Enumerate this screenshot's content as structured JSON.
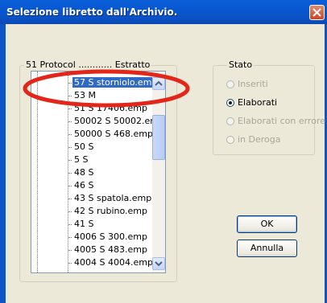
{
  "window": {
    "title": "Selezione libretto dall'Archivio."
  },
  "tree_group": {
    "legend": "51 Protocol ............ Estratto"
  },
  "tree_items": [
    {
      "label": "57 S storniolo.emp",
      "selected": true
    },
    {
      "label": "53 M"
    },
    {
      "label": "51 S 17406.emp"
    },
    {
      "label": "50002 S 50002.emp"
    },
    {
      "label": "50000 S 468.emp"
    },
    {
      "label": "50 S"
    },
    {
      "label": "5 S"
    },
    {
      "label": "48 S"
    },
    {
      "label": "46 S"
    },
    {
      "label": "43 S spatola.emp"
    },
    {
      "label": "42 S rubino.emp"
    },
    {
      "label": "41 S"
    },
    {
      "label": "4006 S 300.emp"
    },
    {
      "label": "4005 S 483.emp"
    },
    {
      "label": "4004 S 4004.emp"
    }
  ],
  "stato": {
    "legend": "Stato",
    "options": [
      {
        "label": "Inseriti",
        "checked": false,
        "enabled": false
      },
      {
        "label": "Elaborati",
        "checked": true,
        "enabled": true
      },
      {
        "label": "Elaborati con errore",
        "checked": false,
        "enabled": false
      },
      {
        "label": "in Deroga",
        "checked": false,
        "enabled": false
      }
    ]
  },
  "buttons": {
    "ok": "OK",
    "cancel": "Annulla"
  },
  "colors": {
    "title_bar": "#0a5fd8",
    "selection": "#316ac5",
    "highlight_oval": "#e32619"
  }
}
